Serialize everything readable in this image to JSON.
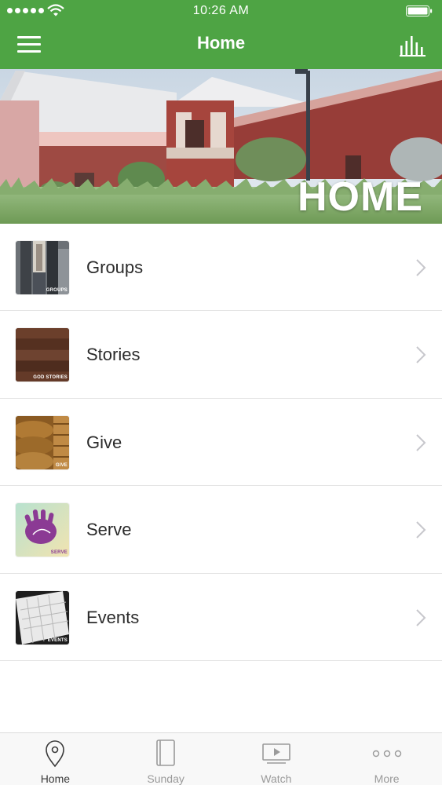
{
  "status_bar": {
    "time": "10:26 AM",
    "signal_icon": "signal-dots-icon",
    "wifi_icon": "wifi-icon",
    "battery_icon": "battery-icon"
  },
  "nav_bar": {
    "title": "Home",
    "menu_icon": "hamburger-menu-icon",
    "right_icon": "bar-chart-icon"
  },
  "hero": {
    "overlay_text": "HOME"
  },
  "menu_items": [
    {
      "label": "Groups",
      "thumb_caption": "GROUPS"
    },
    {
      "label": "Stories",
      "thumb_caption": "GOD STORIES"
    },
    {
      "label": "Give",
      "thumb_caption": "GIVE"
    },
    {
      "label": "Serve",
      "thumb_caption": "SERVE"
    },
    {
      "label": "Events",
      "thumb_caption": "EVENTS"
    }
  ],
  "tab_bar": {
    "tabs": [
      {
        "label": "Home",
        "icon": "map-pin-icon",
        "active": true
      },
      {
        "label": "Sunday",
        "icon": "book-icon",
        "active": false
      },
      {
        "label": "Watch",
        "icon": "play-screen-icon",
        "active": false
      },
      {
        "label": "More",
        "icon": "more-dots-icon",
        "active": false
      }
    ]
  },
  "colors": {
    "header_green": "#4ea444",
    "text_dark": "#2b2b2b",
    "tab_inactive": "#9a9a9a",
    "divider": "#e4e4e4"
  }
}
